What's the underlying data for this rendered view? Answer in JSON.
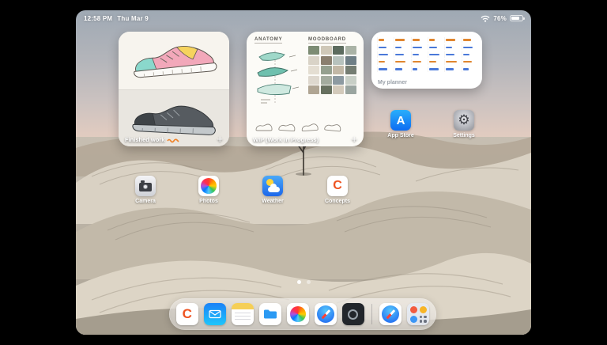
{
  "status_bar": {
    "time": "12:58 PM",
    "date": "Thu Mar 9",
    "battery_percent": "76%"
  },
  "widgets": {
    "finished_work": {
      "label": "Finished work",
      "add_button": "+"
    },
    "wip": {
      "label": "WIP (Work in Progress)",
      "add_button": "+",
      "anatomy_heading": "ANATOMY",
      "moodboard_heading": "MOODBOARD",
      "moodboard_colors": [
        "#7d8c74",
        "#cfc8b8",
        "#5c6b5e",
        "#aab3a6",
        "#d9d3c7",
        "#8a7f6f",
        "#b7c2bd",
        "#6f7f86",
        "#e4ded2",
        "#95a08f",
        "#c2b8a6",
        "#757d72",
        "#ded8ce",
        "#a3ab9e",
        "#8d9aa1",
        "#c8cfc6",
        "#b0a593",
        "#67705f",
        "#d3cabb",
        "#9aa5a0"
      ]
    },
    "planner": {
      "label": "My planner",
      "columns": 6,
      "rows": [
        {
          "color": "#e0862f"
        },
        {
          "color": "#4a79d9"
        },
        {
          "color": "#4a79d9"
        },
        {
          "color": "#e0862f"
        },
        {
          "color": "#4a79d9"
        }
      ]
    }
  },
  "home_icons": [
    {
      "id": "app-store",
      "label": "App Store"
    },
    {
      "id": "settings",
      "label": "Settings"
    },
    {
      "id": "camera",
      "label": "Camera"
    },
    {
      "id": "photos",
      "label": "Photos"
    },
    {
      "id": "weather",
      "label": "Weather"
    },
    {
      "id": "concepts",
      "label": "Concepts"
    }
  ],
  "dock": {
    "items": [
      "concepts",
      "mail",
      "notes",
      "files",
      "photos",
      "safari",
      "camera-lens-app",
      "divider",
      "safari",
      "app-library"
    ]
  },
  "icon_glyphs": {
    "concepts": "C",
    "app_store": "A",
    "settings": "⚙"
  },
  "pagination": {
    "dots": 2,
    "active": 1
  },
  "theme": {
    "dock_background": "rgba(252,252,255,0.42)",
    "label_color": "#ffffff",
    "planner_orange": "#e0862f",
    "planner_blue": "#4a79d9"
  }
}
